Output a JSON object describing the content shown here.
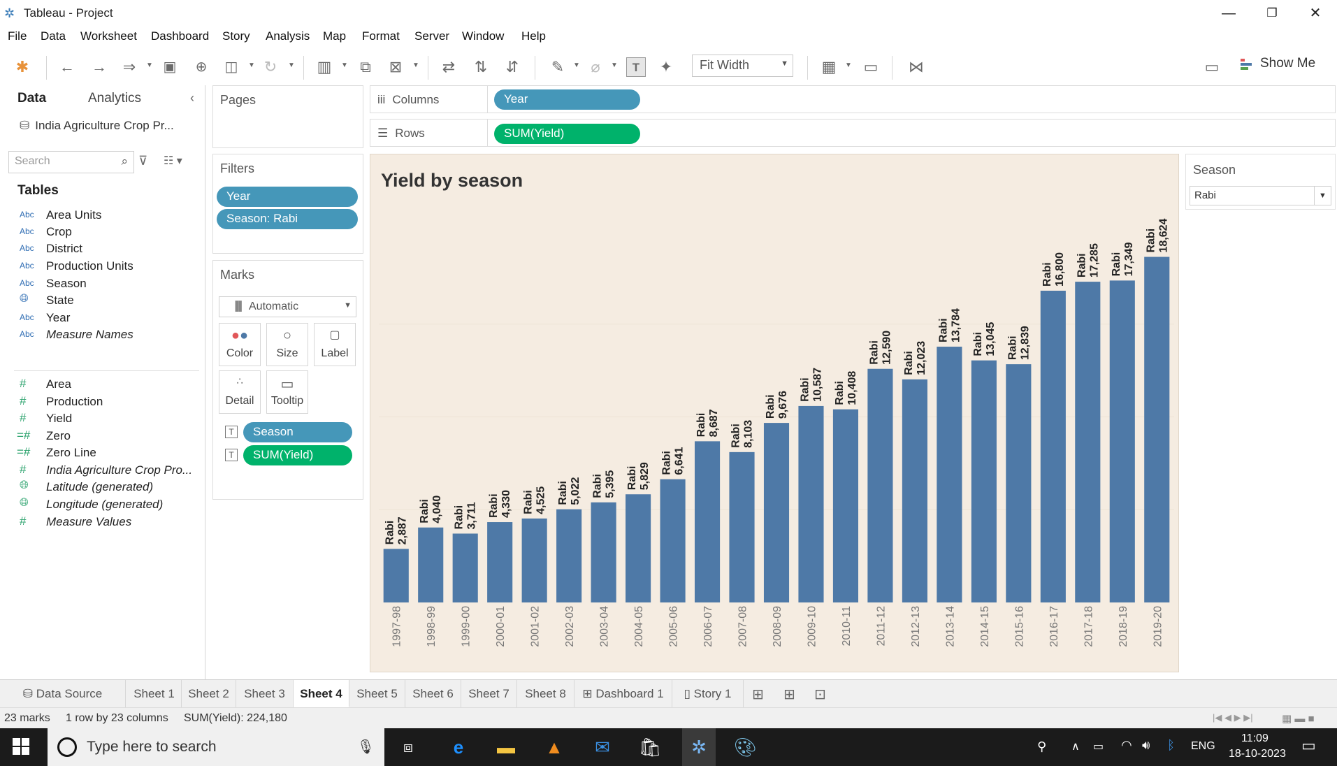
{
  "window": {
    "title": "Tableau - Project"
  },
  "menu": [
    "File",
    "Data",
    "Worksheet",
    "Dashboard",
    "Story",
    "Analysis",
    "Map",
    "Format",
    "Server",
    "Window",
    "Help"
  ],
  "toolbar": {
    "fit_label": "Fit Width",
    "show_me_label": "Show Me"
  },
  "data_pane": {
    "tab_data": "Data",
    "tab_analytics": "Analytics",
    "datasource": "India Agriculture Crop Pr...",
    "search_placeholder": "Search",
    "tables_heading": "Tables",
    "dimensions": [
      {
        "type": "Abc",
        "name": "Area Units"
      },
      {
        "type": "Abc",
        "name": "Crop"
      },
      {
        "type": "Abc",
        "name": "District"
      },
      {
        "type": "Abc",
        "name": "Production Units"
      },
      {
        "type": "Abc",
        "name": "Season"
      },
      {
        "type": "globe",
        "name": "State"
      },
      {
        "type": "Abc",
        "name": "Year"
      },
      {
        "type": "Abc",
        "name": "Measure Names"
      }
    ],
    "measures": [
      {
        "type": "#",
        "name": "Area"
      },
      {
        "type": "#",
        "name": "Production"
      },
      {
        "type": "#",
        "name": "Yield"
      },
      {
        "type": "=#",
        "name": "Zero"
      },
      {
        "type": "=#",
        "name": "Zero Line"
      },
      {
        "type": "#",
        "name": "India Agriculture Crop Pro..."
      },
      {
        "type": "globe",
        "name": "Latitude (generated)"
      },
      {
        "type": "globe",
        "name": "Longitude (generated)"
      },
      {
        "type": "#",
        "name": "Measure Values"
      }
    ]
  },
  "shelves": {
    "pages_label": "Pages",
    "filters_label": "Filters",
    "filters": [
      "Year",
      "Season: Rabi"
    ],
    "marks_label": "Marks",
    "mark_type": "Automatic",
    "mark_buttons": [
      "Color",
      "Size",
      "Label",
      "Detail",
      "Tooltip"
    ],
    "mark_pills": [
      "Season",
      "SUM(Yield)"
    ],
    "columns_label": "Columns",
    "columns_pill": "Year",
    "rows_label": "Rows",
    "rows_pill": "SUM(Yield)"
  },
  "season_filter": {
    "title": "Season",
    "value": "Rabi"
  },
  "chart_data": {
    "type": "bar",
    "title": "Yield by season",
    "categories": [
      "1997-98",
      "1998-99",
      "1999-00",
      "2000-01",
      "2001-02",
      "2002-03",
      "2003-04",
      "2004-05",
      "2005-06",
      "2006-07",
      "2007-08",
      "2008-09",
      "2009-10",
      "2010-11",
      "2011-12",
      "2012-13",
      "2013-14",
      "2014-15",
      "2015-16",
      "2016-17",
      "2017-18",
      "2018-19",
      "2019-20"
    ],
    "series": [
      {
        "name": "Rabi",
        "values": [
          2887,
          4040,
          3711,
          4330,
          4525,
          5022,
          5395,
          5829,
          6641,
          8687,
          8103,
          9676,
          10587,
          10408,
          12590,
          12023,
          13784,
          13045,
          12839,
          16800,
          17285,
          17349,
          18624
        ]
      }
    ],
    "data_labels": [
      "2,887",
      "4,040",
      "3,711",
      "4,330",
      "4,525",
      "5,022",
      "5,395",
      "5,829",
      "6,641",
      "8,687",
      "8,103",
      "9,676",
      "10,587",
      "10,408",
      "12,590",
      "12,023",
      "13,784",
      "13,045",
      "12,839",
      "16,800",
      "17,285",
      "17,349",
      "18,624"
    ],
    "label_prefix": "Rabi",
    "ylim": [
      0,
      20000
    ],
    "bar_color": "#4e79a7",
    "background": "#f5ece1"
  },
  "sheet_tabs": {
    "data_source": "Data Source",
    "sheets": [
      "Sheet 1",
      "Sheet 2",
      "Sheet 3",
      "Sheet 4",
      "Sheet 5",
      "Sheet 6",
      "Sheet 7",
      "Sheet 8"
    ],
    "active": "Sheet 4",
    "dashboard": "Dashboard 1",
    "story": "Story 1"
  },
  "status": {
    "marks": "23 marks",
    "dims": "1 row by 23 columns",
    "sum": "SUM(Yield): 224,180"
  },
  "taskbar": {
    "search_placeholder": "Type here to search",
    "language": "ENG",
    "time": "11:09",
    "date": "18-10-2023"
  }
}
